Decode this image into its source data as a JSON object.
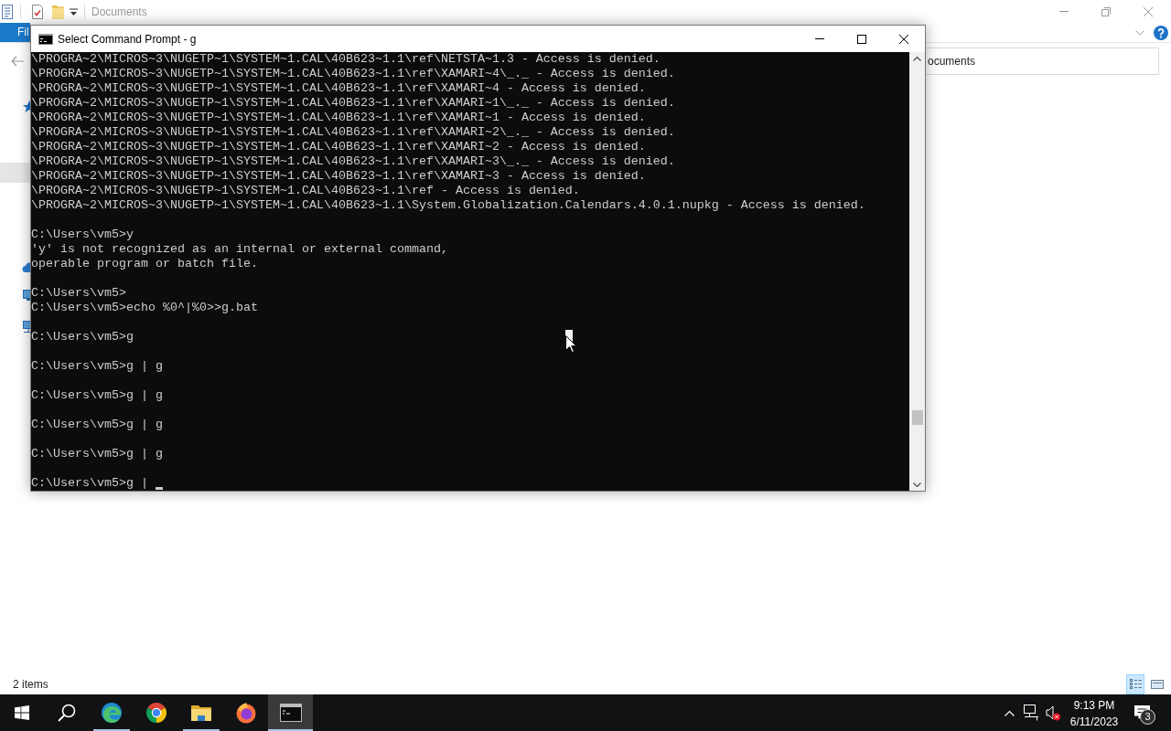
{
  "explorer": {
    "title": "Documents",
    "file_tab": "Fil",
    "address": "ocuments",
    "nav_items": [
      {
        "kind": "star",
        "selected": false
      },
      {
        "kind": "blank",
        "selected": true
      },
      {
        "kind": "cloud",
        "selected": false
      },
      {
        "kind": "computer",
        "selected": false
      },
      {
        "kind": "network",
        "selected": false
      }
    ],
    "status": "2 items",
    "view_buttons": [
      {
        "kind": "list",
        "selected": true
      },
      {
        "kind": "thumbnails",
        "selected": false
      }
    ]
  },
  "console_window": {
    "title": "Select Command Prompt - g",
    "blocks": [
      [
        "\\PROGRA~2\\MICROS~3\\NUGETP~1\\SYSTEM~1.CAL\\40B623~1.1\\ref\\NETSTA~1.3 - Access is denied.",
        "\\PROGRA~2\\MICROS~3\\NUGETP~1\\SYSTEM~1.CAL\\40B623~1.1\\ref\\XAMARI~4\\_._ - Access is denied.",
        "\\PROGRA~2\\MICROS~3\\NUGETP~1\\SYSTEM~1.CAL\\40B623~1.1\\ref\\XAMARI~4 - Access is denied.",
        "\\PROGRA~2\\MICROS~3\\NUGETP~1\\SYSTEM~1.CAL\\40B623~1.1\\ref\\XAMARI~1\\_._ - Access is denied.",
        "\\PROGRA~2\\MICROS~3\\NUGETP~1\\SYSTEM~1.CAL\\40B623~1.1\\ref\\XAMARI~1 - Access is denied.",
        "\\PROGRA~2\\MICROS~3\\NUGETP~1\\SYSTEM~1.CAL\\40B623~1.1\\ref\\XAMARI~2\\_._ - Access is denied.",
        "\\PROGRA~2\\MICROS~3\\NUGETP~1\\SYSTEM~1.CAL\\40B623~1.1\\ref\\XAMARI~2 - Access is denied.",
        "\\PROGRA~2\\MICROS~3\\NUGETP~1\\SYSTEM~1.CAL\\40B623~1.1\\ref\\XAMARI~3\\_._ - Access is denied.",
        "\\PROGRA~2\\MICROS~3\\NUGETP~1\\SYSTEM~1.CAL\\40B623~1.1\\ref\\XAMARI~3 - Access is denied.",
        "\\PROGRA~2\\MICROS~3\\NUGETP~1\\SYSTEM~1.CAL\\40B623~1.1\\ref - Access is denied.",
        "\\PROGRA~2\\MICROS~3\\NUGETP~1\\SYSTEM~1.CAL\\40B623~1.1\\System.Globalization.Calendars.4.0.1.nupkg - Access is denied."
      ],
      [
        "C:\\Users\\vm5>y",
        "'y' is not recognized as an internal or external command,",
        "operable program or batch file."
      ],
      [
        "C:\\Users\\vm5>",
        "C:\\Users\\vm5>echo %0^|%0>>g.bat"
      ],
      [
        "C:\\Users\\vm5>g"
      ],
      [
        "C:\\Users\\vm5>g | g"
      ],
      [
        "C:\\Users\\vm5>g | g"
      ],
      [
        "C:\\Users\\vm5>g | g"
      ],
      [
        "C:\\Users\\vm5>g | g"
      ],
      [
        "C:\\Users\\vm5>g |"
      ]
    ],
    "cursor": true
  },
  "taskbar": {
    "apps": [
      {
        "kind": "swirl",
        "running": true,
        "selected": false
      },
      {
        "kind": "segments",
        "running": false,
        "selected": false
      },
      {
        "kind": "folder",
        "running": true,
        "selected": false
      },
      {
        "kind": "globe",
        "running": false,
        "selected": false
      },
      {
        "kind": "terminal",
        "running": true,
        "selected": true
      }
    ],
    "tray": {
      "volume_muted": true,
      "time": "9:13 PM",
      "date": "6/11/2023",
      "notifications": "3"
    }
  }
}
